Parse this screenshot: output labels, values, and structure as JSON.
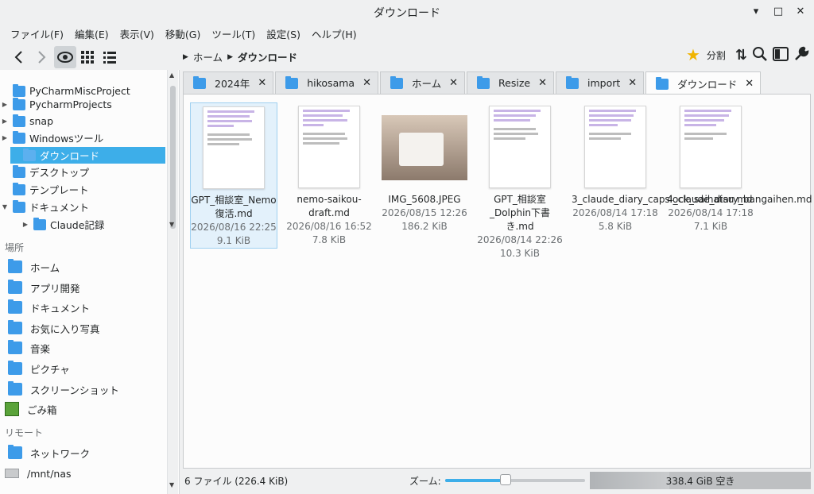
{
  "window": {
    "title": "ダウンロード"
  },
  "menu": [
    "ファイル(F)",
    "編集(E)",
    "表示(V)",
    "移動(G)",
    "ツール(T)",
    "設定(S)",
    "ヘルプ(H)"
  ],
  "breadcrumb": {
    "root": "ホーム",
    "current": "ダウンロード"
  },
  "toolbar": {
    "split_label": "分割"
  },
  "sidebar": {
    "tree": [
      {
        "label": "PyCharmMiscProject",
        "arrow": ""
      },
      {
        "label": "PycharmProjects",
        "arrow": "▶"
      },
      {
        "label": "snap",
        "arrow": "▶"
      },
      {
        "label": "Windowsツール",
        "arrow": "▶"
      },
      {
        "label": "ダウンロード",
        "arrow": "",
        "selected": true
      },
      {
        "label": "デスクトップ",
        "arrow": ""
      },
      {
        "label": "テンプレート",
        "arrow": ""
      },
      {
        "label": "ドキュメント",
        "arrow": "▼"
      },
      {
        "label": "Claude記録",
        "arrow": "▶"
      }
    ],
    "places_heading": "場所",
    "places": [
      "ホーム",
      "アプリ開発",
      "ドキュメント",
      "お気に入り写真",
      "音楽",
      "ピクチャ",
      "スクリーンショット",
      "ごみ箱"
    ],
    "remote_heading": "リモート",
    "remote": [
      "ネットワーク",
      "/mnt/nas"
    ]
  },
  "tabs": [
    "2024年",
    "hikosama",
    "ホーム",
    "Resize",
    "import",
    "ダウンロード"
  ],
  "files": [
    {
      "name": "GPT_相談室_Nemo復活.md",
      "date": "2026/08/16 22:25",
      "size": "9.1 KiB"
    },
    {
      "name": "nemo-saikou-draft.md",
      "date": "2026/08/16 16:52",
      "size": "7.8 KiB"
    },
    {
      "name": "IMG_5608.JPEG",
      "date": "2026/08/15 12:26",
      "size": "186.2 KiB"
    },
    {
      "name": "GPT_相談室_Dolphin下書き.md",
      "date": "2026/08/14 22:26",
      "size": "10.3 KiB"
    },
    {
      "name": "3_claude_diary_capslock_saihatsu.md",
      "date": "2026/08/14 17:18",
      "size": "5.8 KiB"
    },
    {
      "name": "4_claude_diary_bangaihen.md",
      "date": "2026/08/14 17:18",
      "size": "7.1 KiB"
    }
  ],
  "status": {
    "summary": "6 ファイル (226.4 KiB)",
    "zoom_label": "ズーム:",
    "zoom_level": 0.43,
    "free_space": "338.4 GiB 空き",
    "used_fraction": 0.36
  },
  "colors": {
    "accent": "#3daee9",
    "folder": "#3d9be9"
  }
}
